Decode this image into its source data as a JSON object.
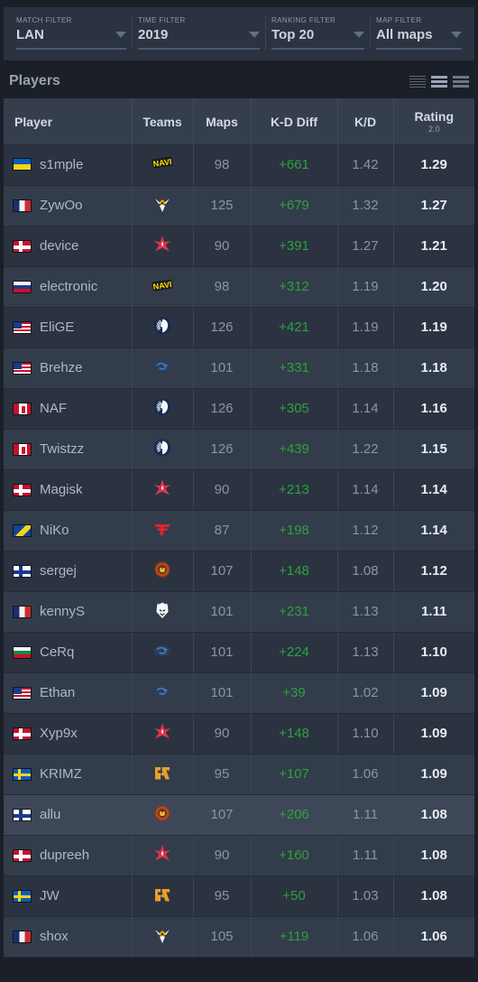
{
  "filters": [
    {
      "name": "match",
      "label": "MATCH FILTER",
      "value": "LAN"
    },
    {
      "name": "time",
      "label": "TIME FILTER",
      "value": "2019"
    },
    {
      "name": "ranking",
      "label": "RANKING FILTER",
      "value": "Top 20"
    },
    {
      "name": "map",
      "label": "MAP FILTER",
      "value": "All maps"
    }
  ],
  "section": {
    "title": "Players",
    "view_modes": [
      "list-compact-icon",
      "list-normal-icon",
      "list-wide-icon"
    ]
  },
  "table": {
    "columns": [
      "Player",
      "Teams",
      "Maps",
      "K-D Diff",
      "K/D",
      "Rating"
    ],
    "rating_sub": "2.0",
    "rows": [
      {
        "player": "s1mple",
        "country": "ua",
        "team": "natus-vincere",
        "maps": "98",
        "kd_diff": "+661",
        "kd": "1.42",
        "rating": "1.29",
        "highlight": false
      },
      {
        "player": "ZywOo",
        "country": "fr",
        "team": "vitality",
        "maps": "125",
        "kd_diff": "+679",
        "kd": "1.32",
        "rating": "1.27",
        "highlight": false
      },
      {
        "player": "device",
        "country": "dk",
        "team": "astralis",
        "maps": "90",
        "kd_diff": "+391",
        "kd": "1.27",
        "rating": "1.21",
        "highlight": false
      },
      {
        "player": "electronic",
        "country": "ru",
        "team": "natus-vincere",
        "maps": "98",
        "kd_diff": "+312",
        "kd": "1.19",
        "rating": "1.20",
        "highlight": false
      },
      {
        "player": "EliGE",
        "country": "us",
        "team": "liquid",
        "maps": "126",
        "kd_diff": "+421",
        "kd": "1.19",
        "rating": "1.19",
        "highlight": false
      },
      {
        "player": "Brehze",
        "country": "us",
        "team": "evil-geniuses",
        "maps": "101",
        "kd_diff": "+331",
        "kd": "1.18",
        "rating": "1.18",
        "highlight": false
      },
      {
        "player": "NAF",
        "country": "ca",
        "team": "liquid",
        "maps": "126",
        "kd_diff": "+305",
        "kd": "1.14",
        "rating": "1.16",
        "highlight": false
      },
      {
        "player": "Twistzz",
        "country": "ca",
        "team": "liquid",
        "maps": "126",
        "kd_diff": "+439",
        "kd": "1.22",
        "rating": "1.15",
        "highlight": false
      },
      {
        "player": "Magisk",
        "country": "dk",
        "team": "astralis",
        "maps": "90",
        "kd_diff": "+213",
        "kd": "1.14",
        "rating": "1.14",
        "highlight": false
      },
      {
        "player": "NiKo",
        "country": "ba",
        "team": "faze",
        "maps": "87",
        "kd_diff": "+198",
        "kd": "1.12",
        "rating": "1.14",
        "highlight": false
      },
      {
        "player": "sergej",
        "country": "fi",
        "team": "ence",
        "maps": "107",
        "kd_diff": "+148",
        "kd": "1.08",
        "rating": "1.12",
        "highlight": false
      },
      {
        "player": "kennyS",
        "country": "fr",
        "team": "g2",
        "maps": "101",
        "kd_diff": "+231",
        "kd": "1.13",
        "rating": "1.11",
        "highlight": false
      },
      {
        "player": "CeRq",
        "country": "bg",
        "team": "evil-geniuses",
        "maps": "101",
        "kd_diff": "+224",
        "kd": "1.13",
        "rating": "1.10",
        "highlight": false
      },
      {
        "player": "Ethan",
        "country": "us",
        "team": "evil-geniuses",
        "maps": "101",
        "kd_diff": "+39",
        "kd": "1.02",
        "rating": "1.09",
        "highlight": false
      },
      {
        "player": "Xyp9x",
        "country": "dk",
        "team": "astralis",
        "maps": "90",
        "kd_diff": "+148",
        "kd": "1.10",
        "rating": "1.09",
        "highlight": false
      },
      {
        "player": "KRIMZ",
        "country": "se",
        "team": "fnatic",
        "maps": "95",
        "kd_diff": "+107",
        "kd": "1.06",
        "rating": "1.09",
        "highlight": false
      },
      {
        "player": "allu",
        "country": "fi",
        "team": "ence",
        "maps": "107",
        "kd_diff": "+206",
        "kd": "1.11",
        "rating": "1.08",
        "highlight": true
      },
      {
        "player": "dupreeh",
        "country": "dk",
        "team": "astralis",
        "maps": "90",
        "kd_diff": "+160",
        "kd": "1.11",
        "rating": "1.08",
        "highlight": false
      },
      {
        "player": "JW",
        "country": "se",
        "team": "fnatic",
        "maps": "95",
        "kd_diff": "+50",
        "kd": "1.03",
        "rating": "1.08",
        "highlight": false
      },
      {
        "player": "shox",
        "country": "fr",
        "team": "vitality",
        "maps": "105",
        "kd_diff": "+119",
        "kd": "1.06",
        "rating": "1.06",
        "highlight": false
      }
    ]
  },
  "colors": {
    "page_bg": "#1b2028",
    "panel_bg": "#2b3341",
    "row_odd": "#333c4a",
    "row_even": "#2b3341",
    "row_hover": "#3d4757",
    "header_bg": "#353e4d",
    "positive_green": "#2fa03e",
    "text_primary": "#d3dae3",
    "text_muted": "#8a95a3"
  }
}
